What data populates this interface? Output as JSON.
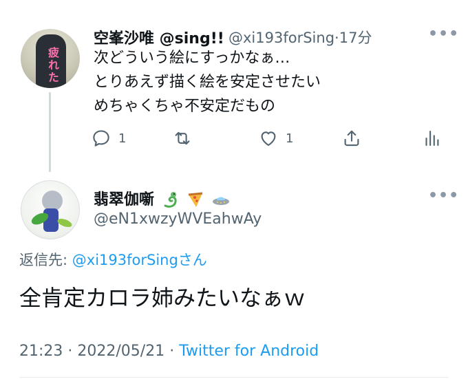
{
  "parent_tweet": {
    "display_name": "空峯沙唯 @sing!!",
    "handle": "@xi193forSing",
    "separator": "·",
    "time_ago": "17分",
    "more_label": "•••",
    "avatar_text": "疲れた",
    "lines": [
      "次どういう絵にすっかなぁ…",
      "とりあえず描く絵を安定させたい",
      "めちゃくちゃ不安定だもの"
    ],
    "actions": {
      "reply_count": "1",
      "retweet_count": "",
      "like_count": "1"
    }
  },
  "reply_tweet": {
    "display_name": "翡翠伽噺",
    "name_emojis": [
      "dragon",
      "pizza",
      "ufo"
    ],
    "handle": "@eN1xwzyWVEahwAy",
    "more_label": "•••",
    "replying_prefix": "返信先: ",
    "replying_handle": "@xi193forSing",
    "replying_suffix": "さん",
    "body": "全肯定カロラ姉みたいなぁｗ",
    "time": "21:23",
    "dot1": " · ",
    "date": "2022/05/21",
    "dot2": " · ",
    "source": "Twitter for Android"
  },
  "colors": {
    "text": "#0f1419",
    "secondary": "#536471",
    "link": "#1d9bf0",
    "thread_line": "#cfd9de"
  }
}
